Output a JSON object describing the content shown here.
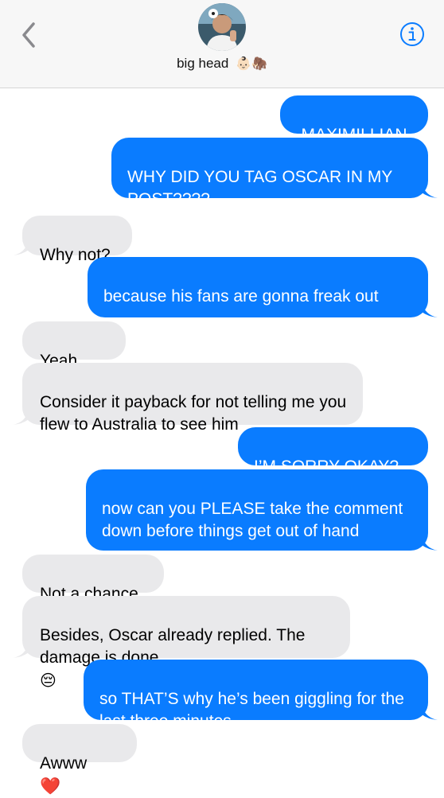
{
  "header": {
    "contact_name": "big head",
    "contact_emojis": "👶🏻🦣"
  },
  "messages": [
    {
      "side": "out",
      "text": "MAXIMILLIAN"
    },
    {
      "side": "out",
      "text": "WHY DID YOU TAG OSCAR IN MY POST????"
    },
    {
      "side": "in",
      "text": "Why not?"
    },
    {
      "side": "out",
      "text": "because his fans are gonna freak out",
      "emoji": "😓"
    },
    {
      "side": "in",
      "text": "Yeah",
      "emoji": "❤️"
    },
    {
      "side": "in",
      "text": "Consider it payback for not telling me you flew to Australia to see him"
    },
    {
      "side": "out",
      "text": "I’M SORRY OKAY?"
    },
    {
      "side": "out",
      "text": "now can you PLEASE take the comment down before things get out of hand"
    },
    {
      "side": "in",
      "text": "Not a chance"
    },
    {
      "side": "in",
      "text": "Besides, Oscar already replied. The damage is done",
      "emoji": "😔"
    },
    {
      "side": "out",
      "text": "so THAT’S why he’s been giggling for the last three minutes..."
    },
    {
      "side": "in",
      "text": "Awww",
      "emoji": "❤️"
    }
  ],
  "colors": {
    "outgoing": "#0a7cff",
    "incoming": "#e9e9eb",
    "accent": "#0a7cff"
  }
}
